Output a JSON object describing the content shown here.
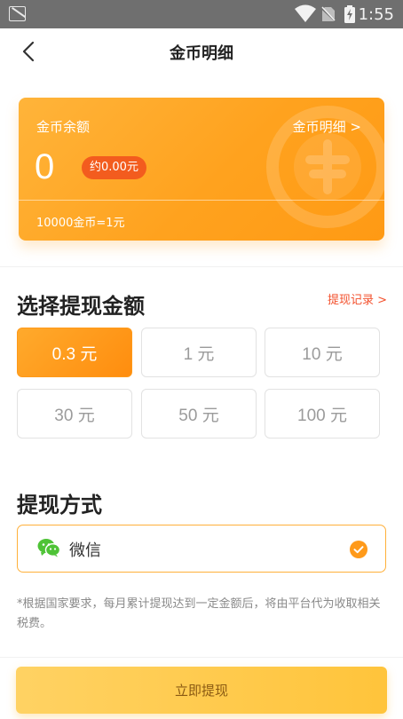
{
  "status_bar": {
    "time": "1:55"
  },
  "header": {
    "title": "金币明细"
  },
  "coin_card": {
    "balance_label": "金币余额",
    "detail_link": "金币明细 >",
    "balance_value": "0",
    "approx_value": "约0.00元",
    "exchange_rate": "10000金币=1元"
  },
  "amount_section": {
    "title": "选择提现金额",
    "records_link": "提现记录 >",
    "options": [
      {
        "label": "0.3 元",
        "selected": true
      },
      {
        "label": "1 元",
        "selected": false
      },
      {
        "label": "10 元",
        "selected": false
      },
      {
        "label": "30 元",
        "selected": false
      },
      {
        "label": "50 元",
        "selected": false
      },
      {
        "label": "100 元",
        "selected": false
      }
    ]
  },
  "method_section": {
    "title": "提现方式",
    "option_label": "微信",
    "selected": true
  },
  "tax_note": "*根据国家要求，每月累计提现达到一定金额后，将由平台代为收取相关税费。",
  "submit_label": "立即提现",
  "colors": {
    "accent": "#ffa21e",
    "badge": "#f35c1e",
    "link_red": "#f3502c",
    "wechat_green": "#4ec336"
  }
}
